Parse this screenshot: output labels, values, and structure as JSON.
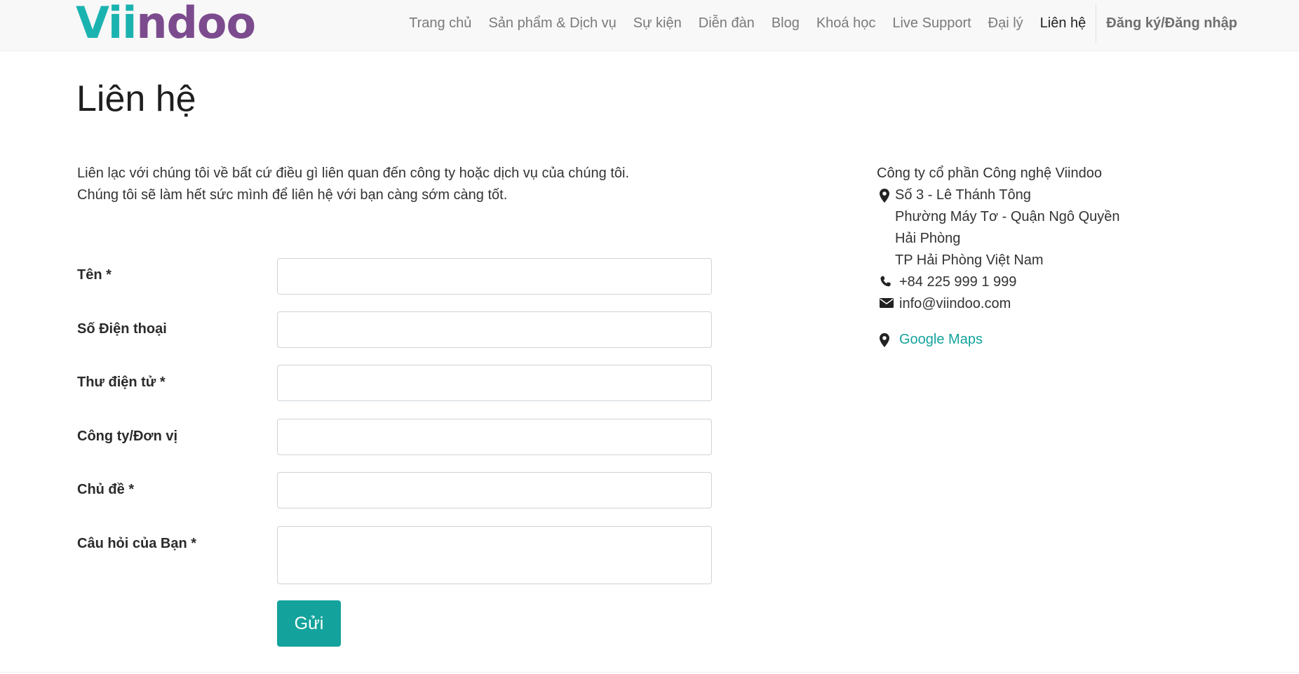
{
  "brand": {
    "logo_part1": "Vii",
    "logo_part2": "ndoo",
    "colors": {
      "teal": "#1bb3b0",
      "purple": "#7c4b8e",
      "accent": "#14a39c"
    }
  },
  "nav": {
    "items": [
      {
        "label": "Trang chủ",
        "active": false
      },
      {
        "label": "Sản phẩm & Dịch vụ",
        "active": false
      },
      {
        "label": "Sự kiện",
        "active": false
      },
      {
        "label": "Diễn đàn",
        "active": false
      },
      {
        "label": "Blog",
        "active": false
      },
      {
        "label": "Khoá học",
        "active": false
      },
      {
        "label": "Live Support",
        "active": false
      },
      {
        "label": "Đại lý",
        "active": false
      },
      {
        "label": "Liên hệ",
        "active": true
      }
    ],
    "login": "Đăng ký/Đăng nhập"
  },
  "page": {
    "title": "Liên hệ",
    "intro_line1": "Liên lạc với chúng tôi về bất cứ điều gì liên quan đến công ty hoặc dịch vụ của chúng tôi.",
    "intro_line2": "Chúng tôi sẽ làm hết sức mình để liên hệ với bạn càng sớm càng tốt."
  },
  "form": {
    "fields": [
      {
        "label": "Tên *",
        "value": ""
      },
      {
        "label": "Số Điện thoại",
        "value": ""
      },
      {
        "label": "Thư điện tử *",
        "value": ""
      },
      {
        "label": "Công ty/Đơn vị",
        "value": ""
      },
      {
        "label": "Chủ đề *",
        "value": ""
      },
      {
        "label": "Câu hỏi của Bạn *",
        "value": ""
      }
    ],
    "submit_label": "Gửi"
  },
  "address": {
    "company": "Công ty cổ phần Công nghệ Viindoo",
    "street": "Số 3 - Lê Thánh Tông",
    "ward": "Phường Máy Tơ - Quận Ngô Quyền",
    "city": "Hải Phòng",
    "province": "TP Hải Phòng Việt Nam",
    "phone": "+84 225 999 1 999",
    "email": "info@viindoo.com",
    "maps_label": "Google Maps",
    "icons": [
      "map-marker-icon",
      "phone-icon",
      "envelope-icon",
      "map-marker-icon"
    ]
  }
}
